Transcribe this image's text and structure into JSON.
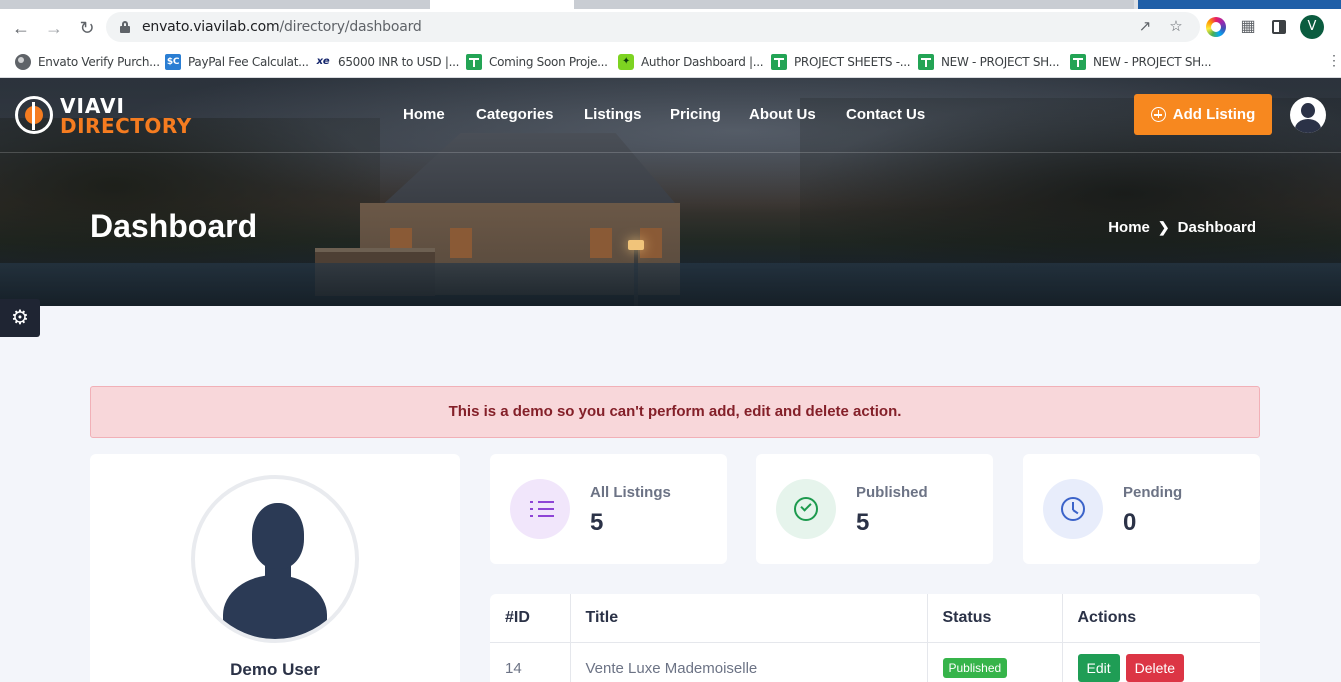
{
  "browser": {
    "url_domain": "envato.viavilab.com",
    "url_path": "/directory/dashboard",
    "profile_initial": "V",
    "bookmarks": [
      {
        "label": "Envato Verify Purch...",
        "icon": "globe-icon"
      },
      {
        "label": "PayPal Fee Calculat...",
        "icon": "paypal-icon"
      },
      {
        "label": "65000 INR to USD |...",
        "icon": "xe-icon"
      },
      {
        "label": "Coming Soon Proje...",
        "icon": "sheets-icon"
      },
      {
        "label": "Author Dashboard |...",
        "icon": "envato-icon"
      },
      {
        "label": "PROJECT SHEETS -...",
        "icon": "sheets-icon"
      },
      {
        "label": "NEW - PROJECT SH...",
        "icon": "sheets-icon"
      },
      {
        "label": "NEW - PROJECT SH...",
        "icon": "sheets-icon"
      }
    ]
  },
  "site": {
    "logo_top": "VIAVI",
    "logo_bottom": "DIRECTORY",
    "nav": [
      "Home",
      "Categories",
      "Listings",
      "Pricing",
      "About Us",
      "Contact Us"
    ],
    "add_listing_label": "Add Listing",
    "accent_color": "#f7881f"
  },
  "hero": {
    "title": "Dashboard",
    "breadcrumb_home": "Home",
    "breadcrumb_current": "Dashboard"
  },
  "alert": {
    "message": "This is a demo so you can't perform add, edit and delete action."
  },
  "profile": {
    "name": "Demo User"
  },
  "stats": [
    {
      "label": "All Listings",
      "value": "5",
      "icon": "list-icon"
    },
    {
      "label": "Published",
      "value": "5",
      "icon": "check-circle-icon"
    },
    {
      "label": "Pending",
      "value": "0",
      "icon": "clock-icon"
    }
  ],
  "table": {
    "headers": [
      "#ID",
      "Title",
      "Status",
      "Actions"
    ],
    "rows": [
      {
        "id": "14",
        "title": "Vente Luxe Mademoiselle",
        "status": "Published",
        "edit": "Edit",
        "delete": "Delete"
      }
    ]
  }
}
